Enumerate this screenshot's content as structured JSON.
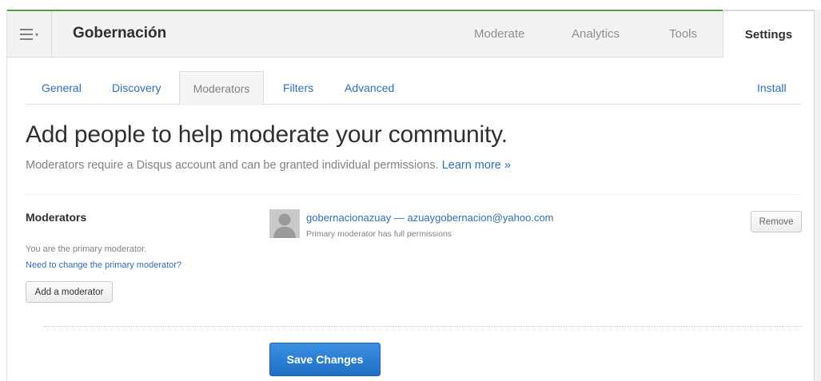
{
  "header": {
    "site_title": "Gobernación",
    "nav": [
      "Moderate",
      "Analytics",
      "Tools",
      "Settings"
    ],
    "active_tab": "Settings"
  },
  "subtabs": {
    "items": [
      "General",
      "Discovery",
      "Moderators",
      "Filters",
      "Advanced"
    ],
    "install": "Install",
    "active": "Moderators"
  },
  "page": {
    "headline": "Add people to help moderate your community.",
    "subtitle": "Moderators require a Disqus account and can be granted individual permissions.",
    "learn_more": "Learn more »"
  },
  "moderators": {
    "section_title": "Moderators",
    "primary_note": "You are the primary moderator.",
    "change_primary_link": "Need to change the primary moderator?",
    "add_button": "Add a moderator",
    "list": [
      {
        "name_line": "gobernacionazuay — azuaygobernacion@yahoo.com",
        "permissions": "Primary moderator has full permissions",
        "remove_label": "Remove",
        "avatar_icon": "default-user-icon"
      }
    ]
  },
  "actions": {
    "save_label": "Save Changes"
  },
  "colors": {
    "accent_green": "#58a339",
    "link_blue": "#2e6fb8",
    "save_blue": "#2a7fd4"
  }
}
